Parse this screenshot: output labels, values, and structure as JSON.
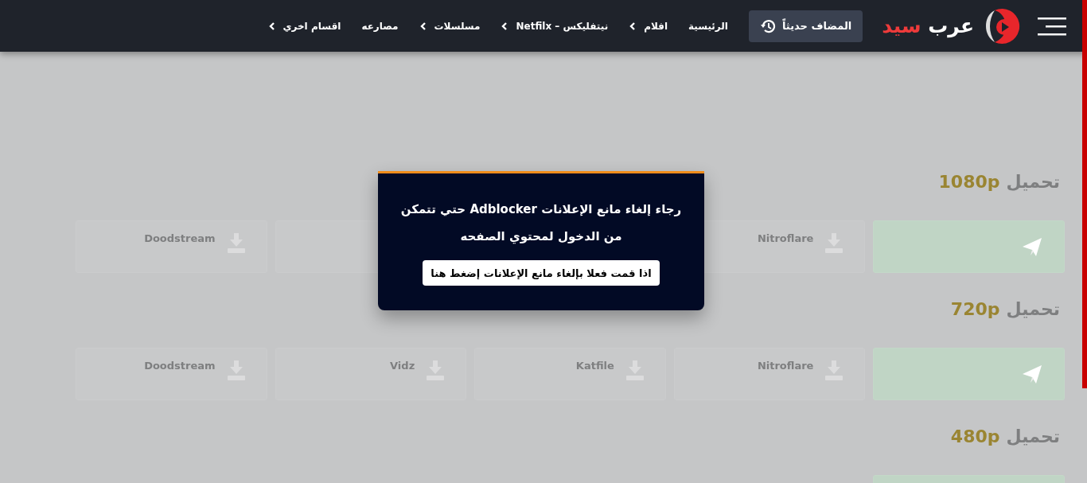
{
  "header": {
    "logo": {
      "first_word": "عرب",
      "second_word": "سيد"
    },
    "recent_button": "المضاف حديثاً",
    "nav": [
      {
        "label": "الرئيسية",
        "has_submenu": false
      },
      {
        "label": "افلام",
        "has_submenu": true
      },
      {
        "label": "نيتفليكس – Netfilx",
        "has_submenu": true
      },
      {
        "label": "مسلسلات",
        "has_submenu": true
      },
      {
        "label": "مصارعه",
        "has_submenu": false
      },
      {
        "label": "اقسام اخري",
        "has_submenu": true
      }
    ]
  },
  "sections": [
    {
      "prefix": "تحميل",
      "quality": "1080p",
      "servers": [
        {
          "kind": "direct"
        },
        {
          "kind": "host",
          "name": "Nitroflare"
        },
        {
          "kind": "host"
        },
        {
          "kind": "host",
          "name": "Doodstream"
        }
      ]
    },
    {
      "prefix": "تحميل",
      "quality": "720p",
      "servers": [
        {
          "kind": "direct"
        },
        {
          "kind": "host",
          "name": "Nitroflare"
        },
        {
          "kind": "host",
          "name": "Katfile"
        },
        {
          "kind": "host",
          "name": "Vidz"
        },
        {
          "kind": "host",
          "name": "Doodstream"
        }
      ]
    },
    {
      "prefix": "تحميل",
      "quality": "480p",
      "servers": [
        {
          "kind": "direct"
        }
      ]
    }
  ],
  "modal": {
    "message": "رجاء إلغاء مانع الإعلانات Adblocker حتي تتمكن من الدخول لمحتوي الصفحه",
    "button": "اذا قمت فعلا بإلغاء مانع الإعلانات إضغط هنا"
  }
}
